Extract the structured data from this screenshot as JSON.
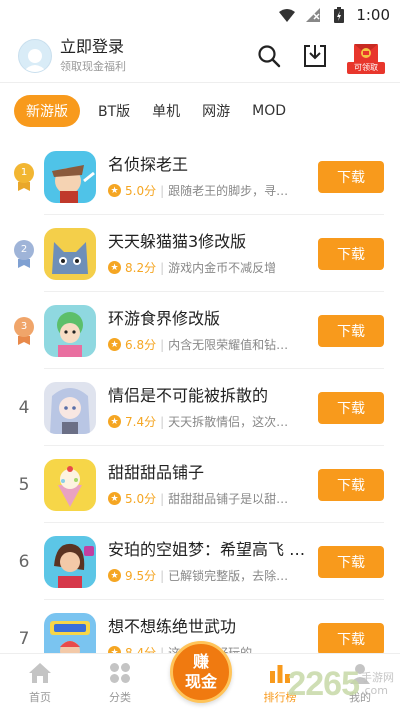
{
  "status_bar": {
    "time": "1:00"
  },
  "header": {
    "login_title": "立即登录",
    "login_subtitle": "领取现金福利",
    "gift_label": "可领取"
  },
  "tabs": [
    {
      "label": "新游版",
      "active": true
    },
    {
      "label": "BT版",
      "active": false
    },
    {
      "label": "单机",
      "active": false
    },
    {
      "label": "网游",
      "active": false
    },
    {
      "label": "MOD",
      "active": false
    }
  ],
  "list": [
    {
      "rank": "1",
      "name": "名侦探老王",
      "score": "5.0分",
      "desc": "跟随老王的脚步，寻…",
      "button": "下载"
    },
    {
      "rank": "2",
      "name": "天天躲猫猫3修改版",
      "score": "8.2分",
      "desc": "游戏内金币不减反增",
      "button": "下载"
    },
    {
      "rank": "3",
      "name": "环游食界修改版",
      "score": "6.8分",
      "desc": "内含无限荣耀值和钻…",
      "button": "下载"
    },
    {
      "rank": "4",
      "name": "情侣是不可能被拆散的",
      "score": "7.4分",
      "desc": "天天拆散情侣，这次…",
      "button": "下载"
    },
    {
      "rank": "5",
      "name": "甜甜甜品铺子",
      "score": "5.0分",
      "desc": "甜甜甜品铺子是以甜…",
      "button": "下载"
    },
    {
      "rank": "6",
      "name": "安珀的空姐梦：希望高飞 …",
      "score": "9.5分",
      "desc": "已解锁完整版，去除…",
      "button": "下载"
    },
    {
      "rank": "7",
      "name": "想不想练绝世武功",
      "score": "8.4分",
      "desc": "这…非常好玩的…",
      "button": "下载"
    }
  ],
  "bottom_nav": {
    "home": "首页",
    "category": "分类",
    "earn_line1": "赚",
    "earn_line2": "现金",
    "ranking": "排行榜",
    "mine": "我的"
  },
  "watermark": {
    "number": "2265",
    "site": "手游网",
    "domain": ".com"
  },
  "colors": {
    "accent": "#f89a1c",
    "star": "#f5a623",
    "gold": "#f2b632",
    "silver": "#9fb4d8",
    "bronze": "#f0a56a"
  }
}
